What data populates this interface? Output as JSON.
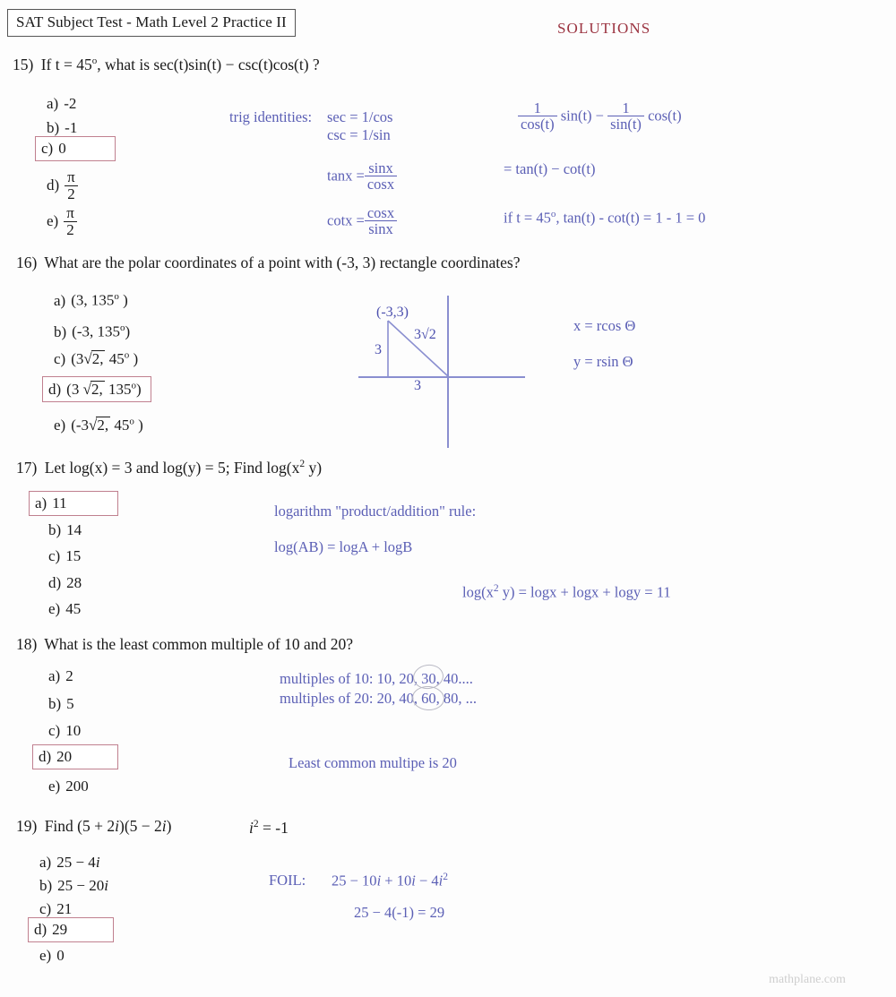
{
  "header": {
    "title": "SAT Subject Test - Math Level 2  Practice II",
    "solutions_label": "SOLUTIONS"
  },
  "footer": {
    "credit": "mathplane.com"
  },
  "colors": {
    "solutions_red": "#9b3340",
    "answer_box_border": "#c0808f",
    "work_blue": "#5b5fb5",
    "graph_blue": "#8a8fd0",
    "footer_gray": "#cfcfcf"
  },
  "questions": [
    {
      "number": "15)",
      "prompt_pre": "If  t = 45",
      "prompt_deg": "o",
      "prompt_post": ",  what is sec(t)sin(t) − csc(t)cos(t) ?",
      "choices": [
        {
          "label": "a)",
          "text": "-2"
        },
        {
          "label": "b)",
          "text": "-1"
        },
        {
          "label": "c)",
          "text": "0"
        },
        {
          "label": "d)",
          "text": ""
        },
        {
          "label": "e)",
          "text": ""
        }
      ],
      "choice_d_frac": {
        "num": "π",
        "den": "2"
      },
      "choice_e_frac": {
        "num": "π",
        "den": "2"
      },
      "correct": "c",
      "work": {
        "identities_label": "trig identities:",
        "sec_identity": "sec =  1/cos",
        "csc_identity": "csc = 1/sin",
        "tan_lhs": "tanx =",
        "tan_num": "sinx",
        "tan_den": "cosx",
        "cot_lhs": "cotx =",
        "cot_num": "cosx",
        "cot_den": "sinx",
        "expr_f1_num": "1",
        "expr_f1_den": "cos(t)",
        "expr_mid1": "sin(t) −",
        "expr_f2_num": "1",
        "expr_f2_den": "sin(t)",
        "expr_mid2": "cos(t)",
        "line_equals": "=   tan(t) − cot(t)",
        "line_if_pre": "if t = 45",
        "line_if_deg": "o",
        "line_if_post": ",   tan(t) - cot(t) = 1 - 1 = 0"
      }
    },
    {
      "number": "16)",
      "prompt": "What are the polar coordinates of a point with  (-3, 3) rectangle coordinates?",
      "choices": [
        {
          "label": "a)",
          "text": "(3, 135",
          "deg": "o",
          "tail": " )"
        },
        {
          "label": "b)",
          "text": "(-3, 135",
          "deg": "o",
          "tail": ")"
        },
        {
          "label": "c)",
          "pre": "(3",
          "rad": "2,",
          "post": " 45",
          "deg": "o",
          "tail": " )"
        },
        {
          "label": "d)",
          "pre": "(3 ",
          "rad": "2,",
          "post": " 135",
          "deg": "o",
          "tail": ")"
        },
        {
          "label": "e)",
          "pre": "(-3",
          "rad": "2,",
          "post": "  45",
          "deg": "o",
          "tail": " )"
        }
      ],
      "correct": "d",
      "graph": {
        "point_label": "(-3,3)",
        "vertical_leg": "3",
        "horizontal_leg": "3",
        "hypotenuse": "3√2"
      },
      "work": {
        "x_formula": "x = rcos Θ",
        "y_formula": "y = rsin Θ"
      }
    },
    {
      "number": "17)",
      "prompt_pre": "Let log(x) = 3  and  log(y) = 5;   Find log(x",
      "prompt_sup": "2",
      "prompt_post": " y)",
      "choices": [
        {
          "label": "a)",
          "text": "11"
        },
        {
          "label": "b)",
          "text": "14"
        },
        {
          "label": "c)",
          "text": "15"
        },
        {
          "label": "d)",
          "text": "28"
        },
        {
          "label": "e)",
          "text": "45"
        }
      ],
      "correct": "a",
      "work": {
        "rule_title": "logarithm \"product/addition\" rule:",
        "rule": "log(AB) = logA + logB",
        "calc_pre": "log(x",
        "calc_sup": "2",
        "calc_post": " y) =  logx + logx + logy = 11"
      }
    },
    {
      "number": "18)",
      "prompt": "What is the least common multiple of 10 and 20?",
      "choices": [
        {
          "label": "a)",
          "text": "2"
        },
        {
          "label": "b)",
          "text": "5"
        },
        {
          "label": "c)",
          "text": "10"
        },
        {
          "label": "d)",
          "text": "20"
        },
        {
          "label": "e)",
          "text": "200"
        }
      ],
      "correct": "d",
      "work": {
        "multiples_10": "multiples of 10:  10, 20, 30, 40....",
        "multiples_20": "multiples of 20:  20, 40, 60, 80, ...",
        "conclusion": "Least common multipe is  20"
      }
    },
    {
      "number": "19)",
      "prompt_pre": "Find  (5 + 2",
      "prompt_i1": "i",
      "prompt_mid": ")(5 − 2",
      "prompt_i2": "i",
      "prompt_post": ")",
      "i_squared_base": "i",
      "i_squared_sup": "2",
      "i_squared_val": " = -1",
      "choices": [
        {
          "label": "a)",
          "text": "25 − 4",
          "italic": "i"
        },
        {
          "label": "b)",
          "text": "25 − 20",
          "italic": "i"
        },
        {
          "label": "c)",
          "text": "21"
        },
        {
          "label": "d)",
          "text": "29"
        },
        {
          "label": "e)",
          "text": "0"
        }
      ],
      "correct": "d",
      "work": {
        "foil_label": "FOIL:",
        "foil_line_pre": "25 − 10",
        "foil_i1": "i",
        "foil_line_mid": " + 10",
        "foil_i2": "i",
        "foil_line_mid2": " − 4",
        "foil_i3": "i",
        "foil_sup": "2",
        "foil_line2": "25 − 4(-1)  =  29"
      }
    }
  ]
}
